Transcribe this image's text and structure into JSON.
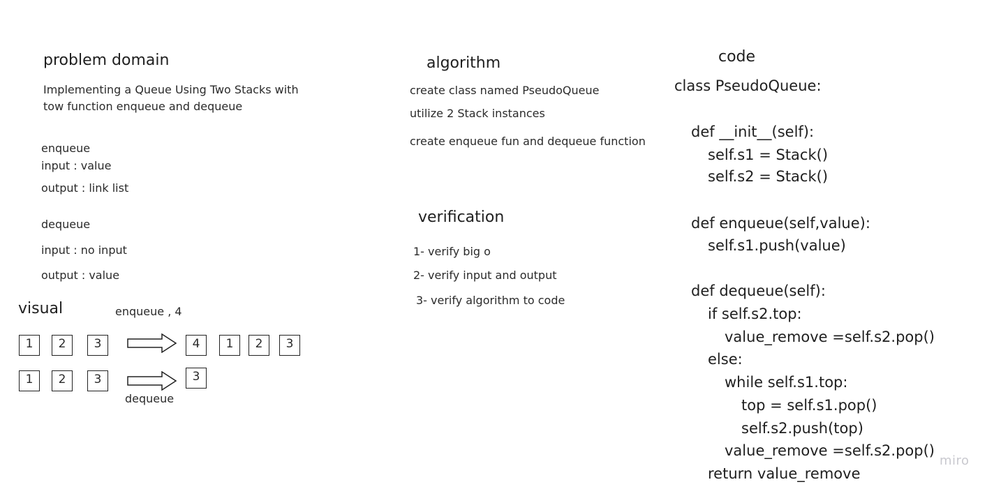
{
  "problem_domain": {
    "title": "problem domain",
    "description_lines": [
      "Implementing a Queue Using Two Stacks with",
      "tow function enqueue and dequeue"
    ],
    "enqueue": {
      "label": "enqueue",
      "input": "input  :   value",
      "output": "output : link list"
    },
    "dequeue": {
      "label": "dequeue",
      "input": "input  :  no input",
      "output": "output : value"
    }
  },
  "algorithm": {
    "title": "algorithm",
    "steps": [
      "create class named PseudoQueue",
      "utilize 2 Stack instances",
      "create enqueue fun and dequeue function"
    ]
  },
  "verification": {
    "title": "verification",
    "items": [
      "1- verify big o",
      "2- verify input and output",
      "3- verify algorithm to code"
    ]
  },
  "visual": {
    "title": "visual",
    "enqueue_caption": "enqueue  , 4",
    "dequeue_caption": "dequeue",
    "row1_left": [
      "1",
      "2",
      "3"
    ],
    "row1_right": [
      "4",
      "1",
      "2",
      "3"
    ],
    "row2_left": [
      "1",
      "2",
      "3"
    ],
    "row2_right": [
      "3"
    ]
  },
  "code": {
    "title": "code",
    "lines": [
      "class PseudoQueue:",
      "",
      "def __init__(self):",
      "self.s1 = Stack()",
      "self.s2 = Stack()",
      "",
      "def enqueue(self,value):",
      "self.s1.push(value)",
      "",
      "def dequeue(self):",
      "if self.s2.top:",
      "value_remove =self.s2.pop()",
      "else:",
      "while self.s1.top:",
      "top = self.s1.pop()",
      "self.s2.push(top)",
      "value_remove =self.s2.pop()",
      "return value_remove"
    ]
  },
  "watermark": "miro"
}
